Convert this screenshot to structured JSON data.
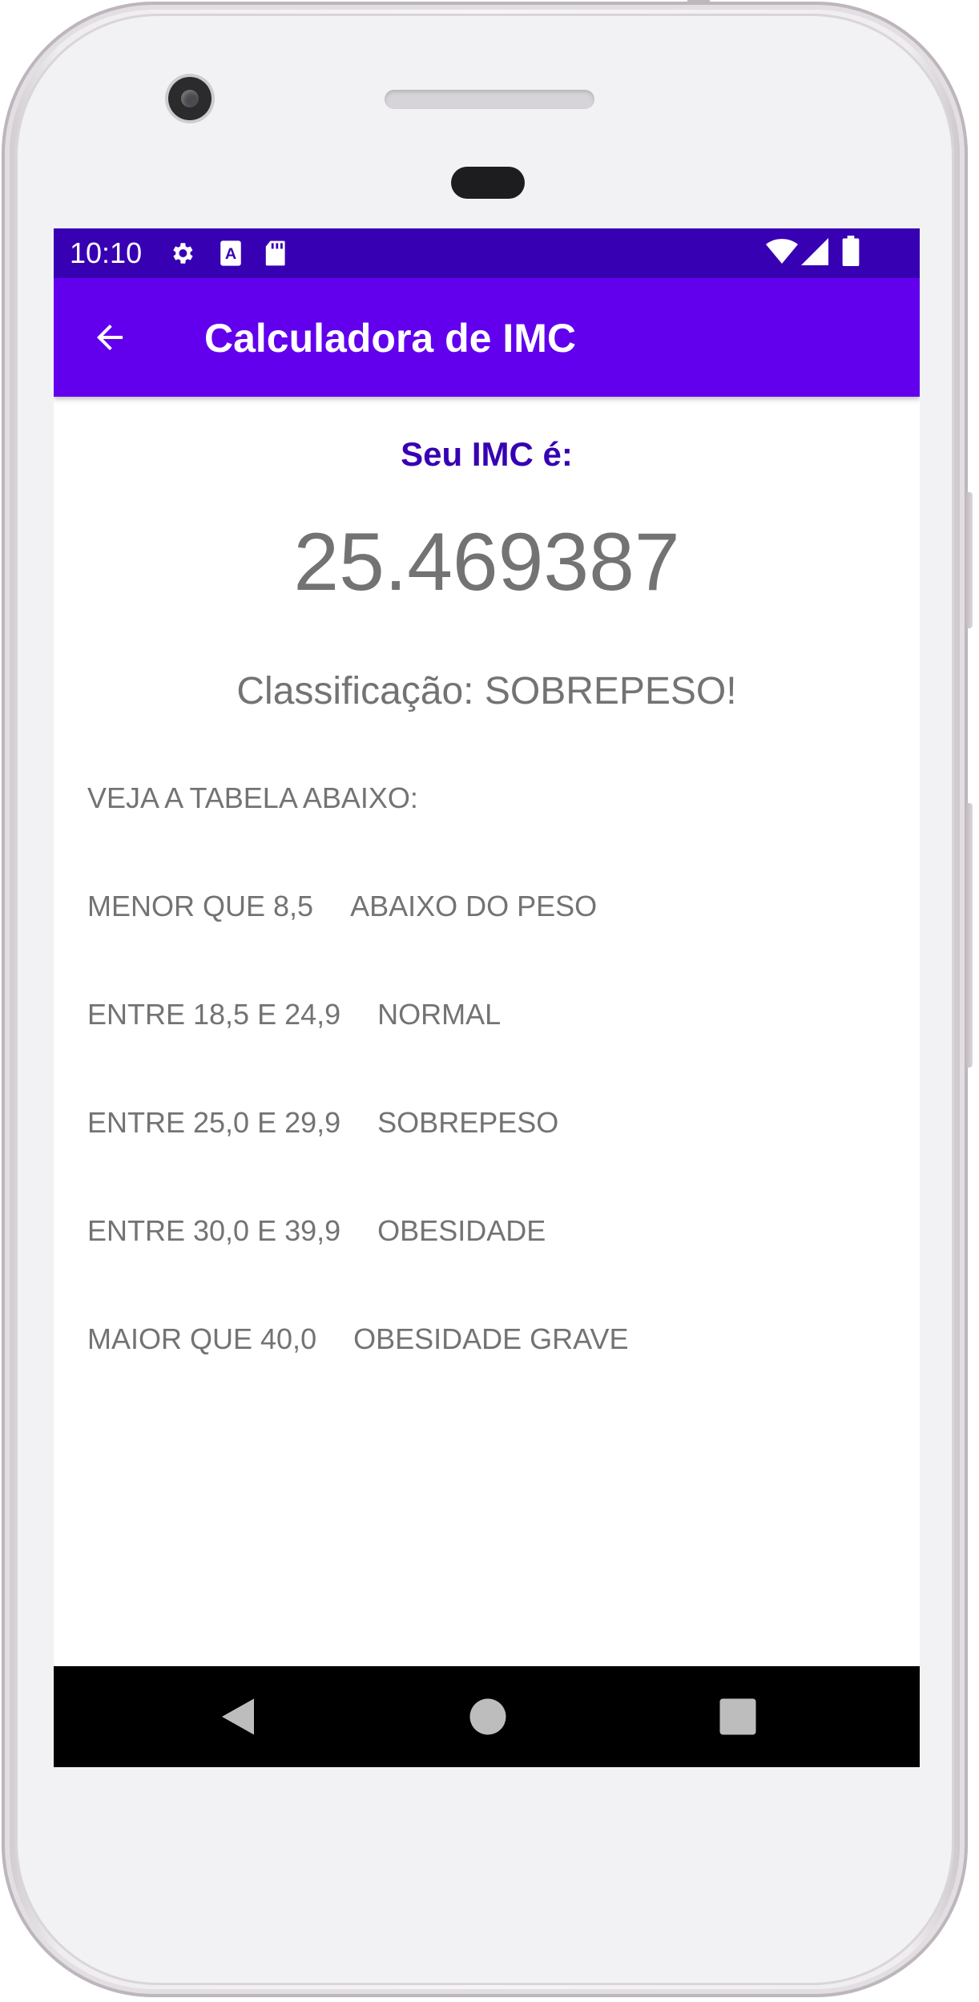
{
  "status_bar": {
    "time": "10:10",
    "left_icons": [
      "gear-icon",
      "text-a-icon",
      "sd-card-icon"
    ],
    "right_icons": [
      "wifi-icon",
      "signal-icon",
      "battery-icon"
    ]
  },
  "app_bar": {
    "title": "Calculadora de IMC",
    "back_icon": "arrow-left-icon"
  },
  "result": {
    "label": "Seu IMC é:",
    "value": "25.469387",
    "classification": "Classificação: SOBREPESO!"
  },
  "table": {
    "title": "VEJA A TABELA ABAIXO:",
    "rows": [
      {
        "range": "MENOR QUE 8,5",
        "category": "ABAIXO DO PESO"
      },
      {
        "range": "ENTRE 18,5 E 24,9",
        "category": "NORMAL"
      },
      {
        "range": "ENTRE 25,0 E 29,9",
        "category": "SOBREPESO"
      },
      {
        "range": "ENTRE 30,0 E 39,9",
        "category": "OBESIDADE"
      },
      {
        "range": "MAIOR QUE 40,0",
        "category": "OBESIDADE GRAVE"
      }
    ]
  },
  "nav_bar": {
    "icons": [
      "back-triangle-icon",
      "home-circle-icon",
      "recents-square-icon"
    ]
  },
  "colors": {
    "status_bar": "#3700b3",
    "app_bar": "#6200ee",
    "accent_text": "#3700b3",
    "body_text": "#737373"
  }
}
